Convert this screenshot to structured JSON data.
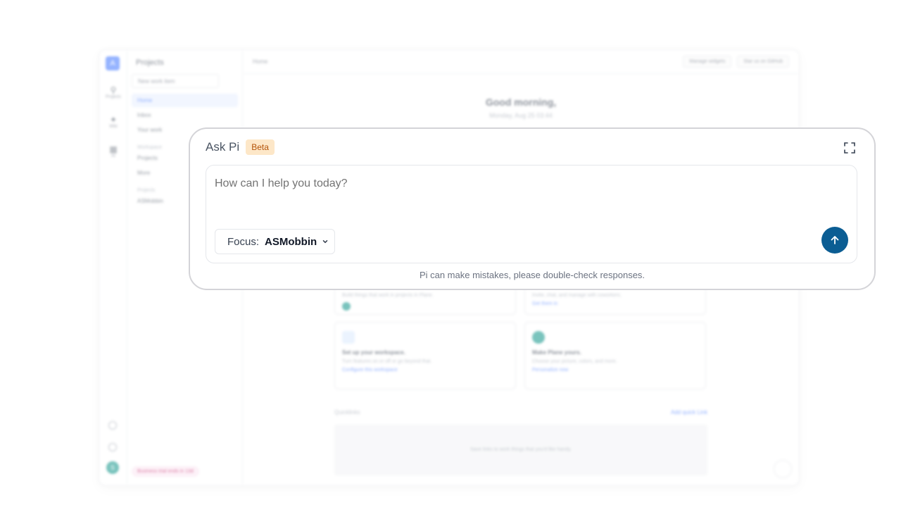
{
  "background": {
    "workspace_initial": "A",
    "rail": [
      {
        "label": "Projects"
      },
      {
        "label": "Wiki"
      },
      {
        "label": "AI"
      }
    ],
    "user_initial": "S",
    "sidebar": {
      "title": "Projects",
      "new_work_item": "New work item",
      "items": [
        "Home",
        "Inbox",
        "Your work"
      ],
      "workspace_section": "Workspace",
      "workspace_items": [
        "Projects",
        "More"
      ],
      "projects_section": "Projects",
      "project_items": [
        "ASMobbin"
      ],
      "bottom_badge": "Business trial ends in 13d"
    },
    "topbar": {
      "breadcrumb": "Home",
      "manage_widgets": "Manage widgets",
      "star_github": "Star us on GitHub"
    },
    "greeting": "Good morning,",
    "date": "Monday, Aug 25 03:44",
    "cards": [
      {
        "title": "",
        "desc": "Build things that work in projects in Plane.",
        "link": ""
      },
      {
        "title": "",
        "desc": "Invite, chat, and manage with coworkers.",
        "link": "Get them in"
      },
      {
        "title": "Set up your workspace.",
        "desc": "Turn features on or off or go beyond that.",
        "link": "Configure this workspace"
      },
      {
        "title": "Make Plane yours.",
        "desc": "Choose your picture, colors, and more.",
        "link": "Personalize now"
      }
    ],
    "quicklinks": {
      "title": "Quicklinks",
      "add": "Add quick Link",
      "empty": "Save links to work things that you'd like handy."
    }
  },
  "modal": {
    "title": "Ask Pi",
    "badge": "Beta",
    "input_placeholder": "How can I help you today?",
    "input_value": "",
    "focus_label": "Focus:",
    "focus_value": "ASMobbin",
    "disclaimer": "Pi can make mistakes, please double-check responses.",
    "icons": {
      "expand": "expand-icon",
      "chevron": "chevron-down-icon",
      "send": "arrow-up-icon"
    },
    "colors": {
      "send_button": "#0b5d93",
      "badge_bg": "#fde7c8",
      "badge_text": "#b45309"
    }
  }
}
